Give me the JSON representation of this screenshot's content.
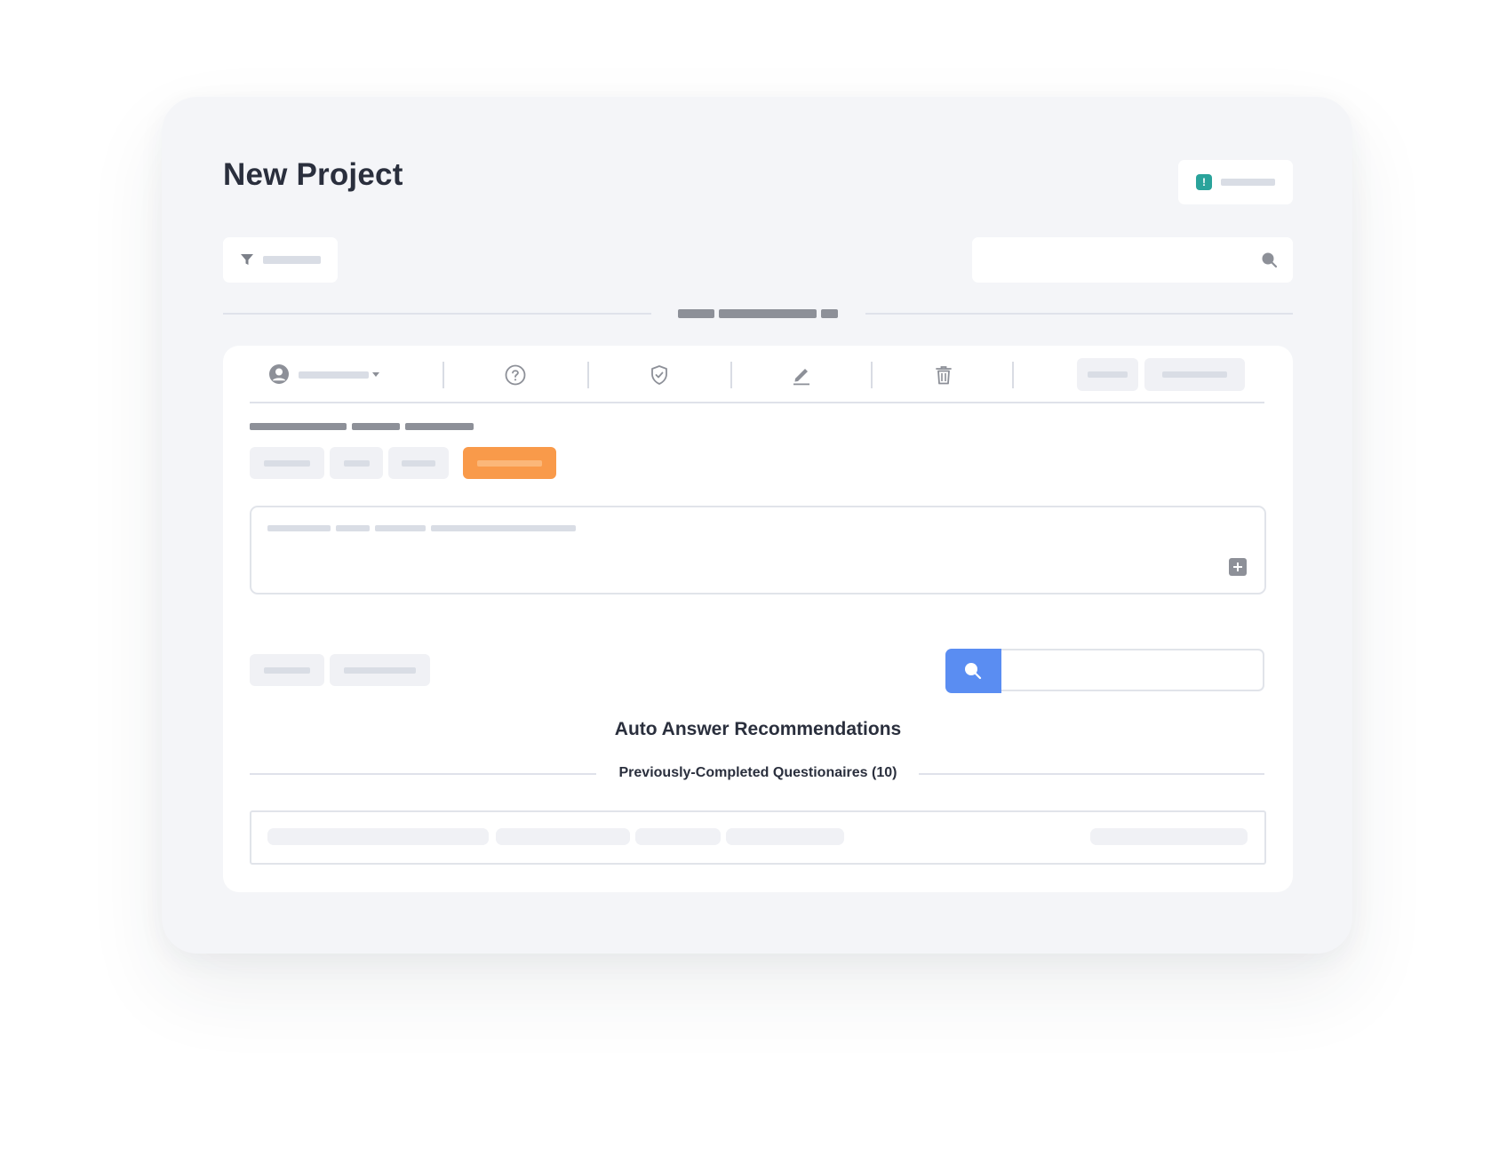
{
  "page": {
    "title": "New Project"
  },
  "status_chip": {
    "icon": "alert-icon",
    "color": "#2aa39b"
  },
  "filter_button": {
    "icon": "filter-icon"
  },
  "search": {
    "icon": "search-icon",
    "placeholder": ""
  },
  "toolbar": {
    "icons": [
      "user-icon",
      "help-icon",
      "shield-check-icon",
      "edit-icon",
      "trash-icon"
    ]
  },
  "tags": {
    "accent_color": "#f99a4a"
  },
  "editor": {
    "add_icon": "plus-icon"
  },
  "answer_search": {
    "icon": "search-icon",
    "accent_color": "#5a8df2",
    "placeholder": ""
  },
  "recommendations": {
    "heading": "Auto Answer Recommendations",
    "section_label": "Previously-Completed Questionaires (10)"
  }
}
